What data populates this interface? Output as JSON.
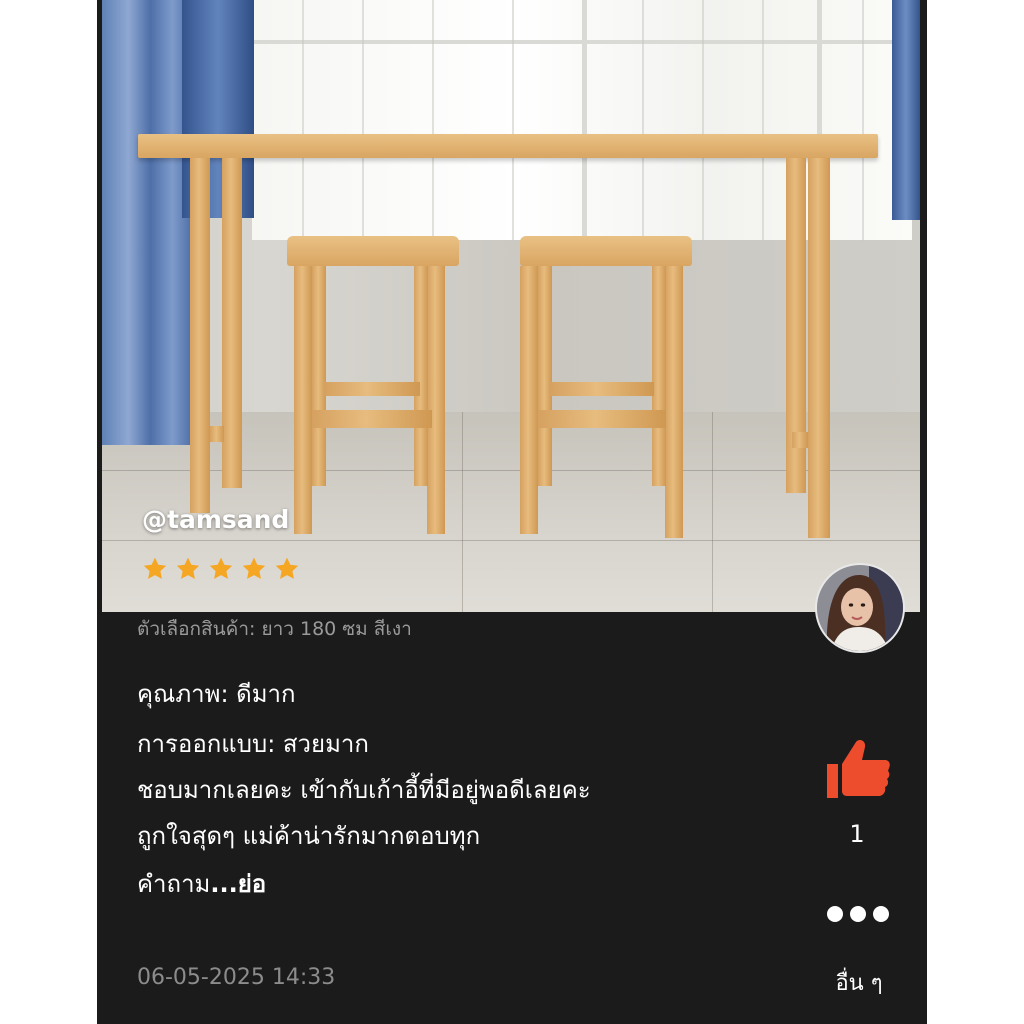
{
  "review": {
    "username": "@tamsand",
    "rating": 5,
    "rating_max": 5,
    "variation": "ตัวเลือกสินค้า: ยาว 180 ซม สีเงา",
    "quality": "คุณภาพ: ดีมาก",
    "design": "การออกแบบ: สวยมาก",
    "comment_line1": "ชอบมากเลยคะ เข้ากับเก้าอี้ที่มีอยู่พอดีเลยคะ",
    "comment_line2": "ถูกใจสุดๆ แม่ค้าน่ารักมากตอบทุก",
    "comment_line3": "คำถาม",
    "read_more": "...ย่อ",
    "timestamp": "06-05-2025 14:33"
  },
  "actions": {
    "like_icon": "thumbs-up-icon",
    "like_count": "1",
    "more_icon": "more-dots-icon",
    "more_label": "อื่น ๆ"
  },
  "colors": {
    "background": "#1b1b1b",
    "star": "#f5a623",
    "like": "#ee4d2d",
    "text": "#ffffff",
    "muted": "#9a9a9a"
  }
}
